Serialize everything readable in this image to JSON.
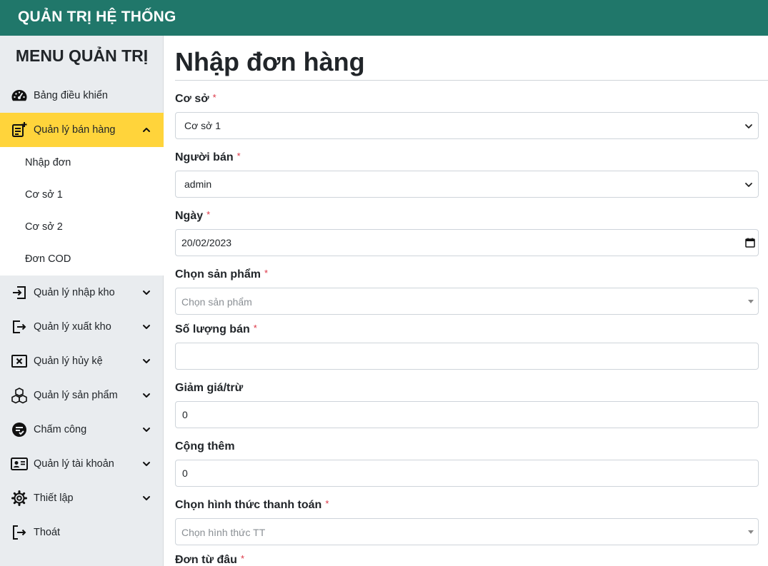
{
  "header": {
    "title": "QUẢN TRỊ HỆ THỐNG"
  },
  "sidebar": {
    "title": "MENU QUẢN TRỊ",
    "items": [
      {
        "label": "Bảng điều khiển",
        "icon": "dashboard-icon"
      },
      {
        "label": "Quản lý bán hàng",
        "icon": "order-add-icon",
        "active": true,
        "expanded": true
      },
      {
        "label": "Quản lý nhập kho",
        "icon": "import-icon"
      },
      {
        "label": "Quản lý xuất kho",
        "icon": "export-icon"
      },
      {
        "label": "Quản lý hủy kệ",
        "icon": "cancel-box-icon"
      },
      {
        "label": "Quản lý sản phẩm",
        "icon": "boxes-icon"
      },
      {
        "label": "Chấm công",
        "icon": "timesheet-icon"
      },
      {
        "label": "Quản lý tài khoản",
        "icon": "id-card-icon"
      },
      {
        "label": "Thiết lập",
        "icon": "gear-icon"
      },
      {
        "label": "Thoát",
        "icon": "logout-icon"
      }
    ],
    "submenu": [
      "Nhập đơn",
      "Cơ sở 1",
      "Cơ sở 2",
      "Đơn COD"
    ]
  },
  "main": {
    "title": "Nhập đơn hàng",
    "fields": {
      "co_so": {
        "label": "Cơ sở",
        "required": "*",
        "value": "Cơ sở 1"
      },
      "nguoi_ban": {
        "label": "Người bán",
        "required": "*",
        "value": "admin"
      },
      "ngay": {
        "label": "Ngày",
        "required": "*",
        "value": "20/02/2023"
      },
      "san_pham": {
        "label": "Chọn sản phẩm",
        "required": "*",
        "placeholder": "Chọn sản phẩm"
      },
      "so_luong": {
        "label": "Số lượng bán",
        "required": "*",
        "value": ""
      },
      "giam_gia": {
        "label": "Giảm giá/trừ",
        "value": "0"
      },
      "cong_them": {
        "label": "Cộng thêm",
        "value": "0"
      },
      "thanh_toan": {
        "label": "Chọn hình thức thanh toán",
        "required": "*",
        "placeholder": "Chọn hình thức TT"
      },
      "don_tu_dau": {
        "label": "Đơn từ đâu",
        "required": "*"
      }
    }
  },
  "colors": {
    "header_bg": "#20776a",
    "active_bg": "#ffd43b",
    "required": "#dc3545",
    "sidebar_bg": "#e9ecef"
  }
}
